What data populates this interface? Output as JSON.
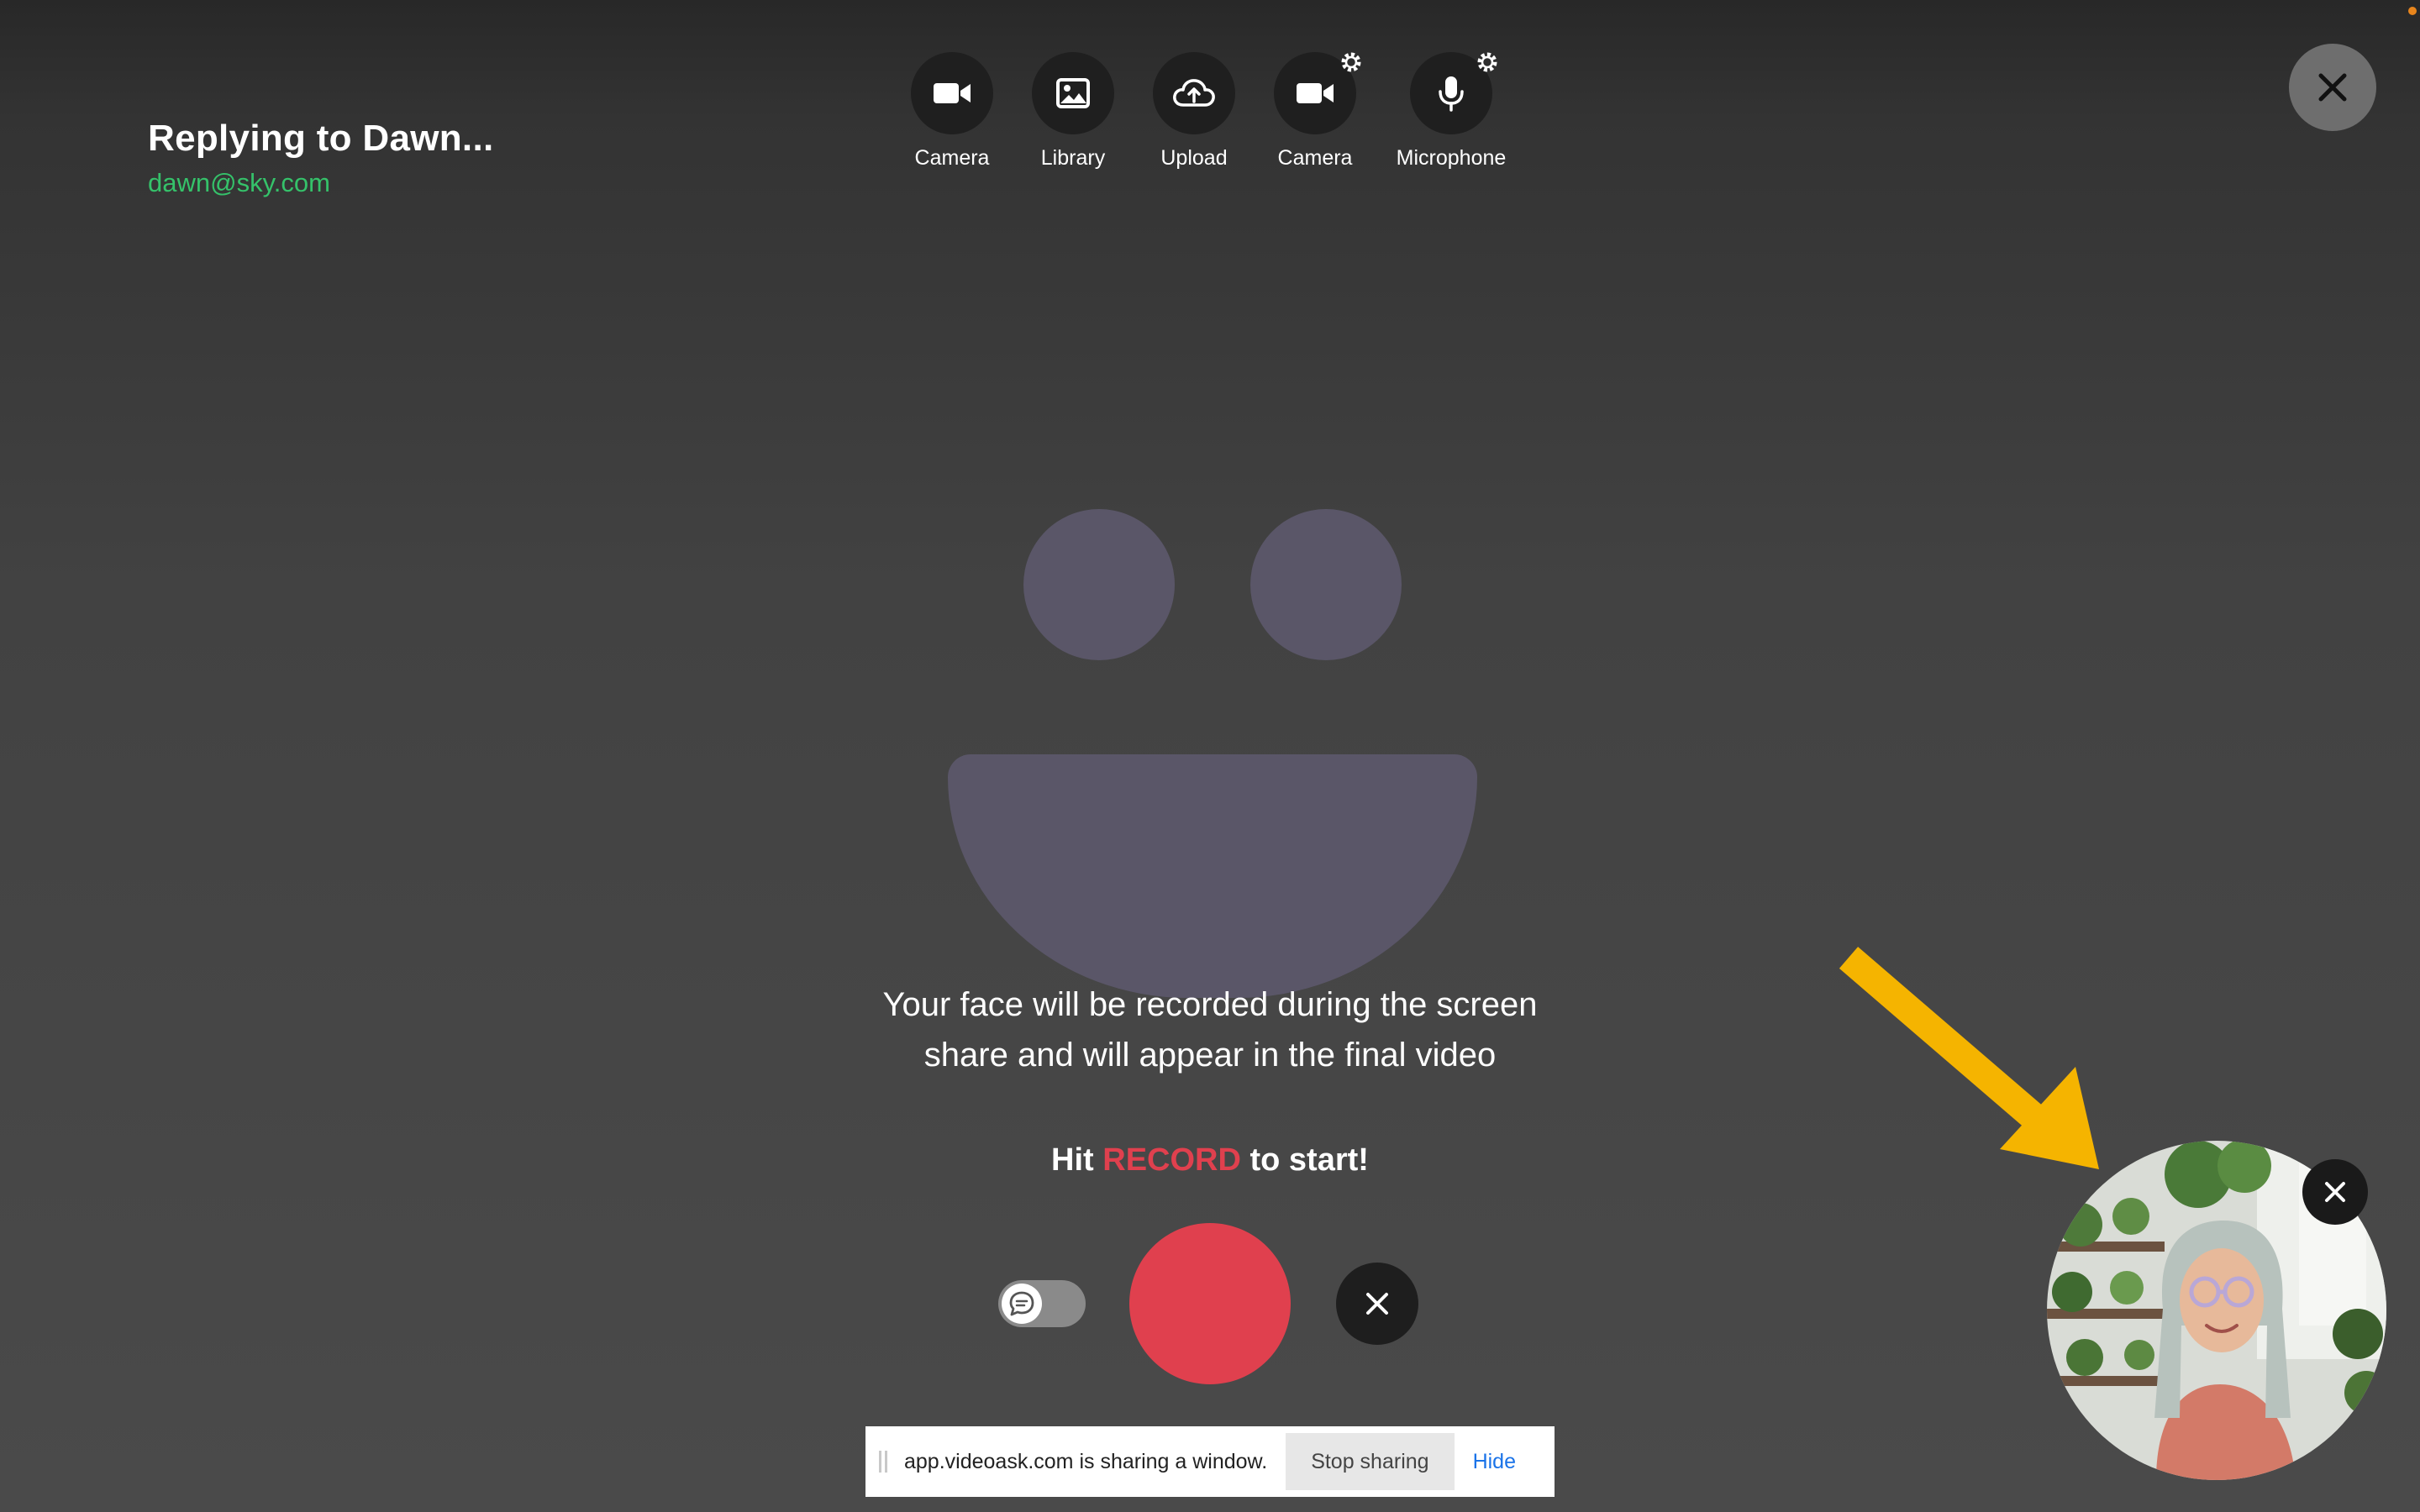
{
  "header": {
    "title": "Replying to Dawn...",
    "email": "dawn@sky.com"
  },
  "toolbar": {
    "items": [
      {
        "label": "Camera",
        "icon": "video-camera-icon"
      },
      {
        "label": "Library",
        "icon": "image-icon"
      },
      {
        "label": "Upload",
        "icon": "cloud-upload-icon"
      },
      {
        "label": "Camera",
        "icon": "video-camera-settings-icon"
      },
      {
        "label": "Microphone",
        "icon": "microphone-settings-icon"
      }
    ]
  },
  "main": {
    "message_line1": "Your face will be recorded during the screen",
    "message_line2": "share and will appear in the final video",
    "hit_prefix": "Hit",
    "hit_record": "RECORD",
    "hit_suffix": "to start!"
  },
  "share_bar": {
    "text": "app.videoask.com is sharing a window.",
    "stop_label": "Stop sharing",
    "hide_label": "Hide"
  },
  "colors": {
    "accent_green": "#35c26a",
    "record_red": "#e0404e",
    "arrow_yellow": "#f5b400",
    "smiley": "#5a5668"
  }
}
